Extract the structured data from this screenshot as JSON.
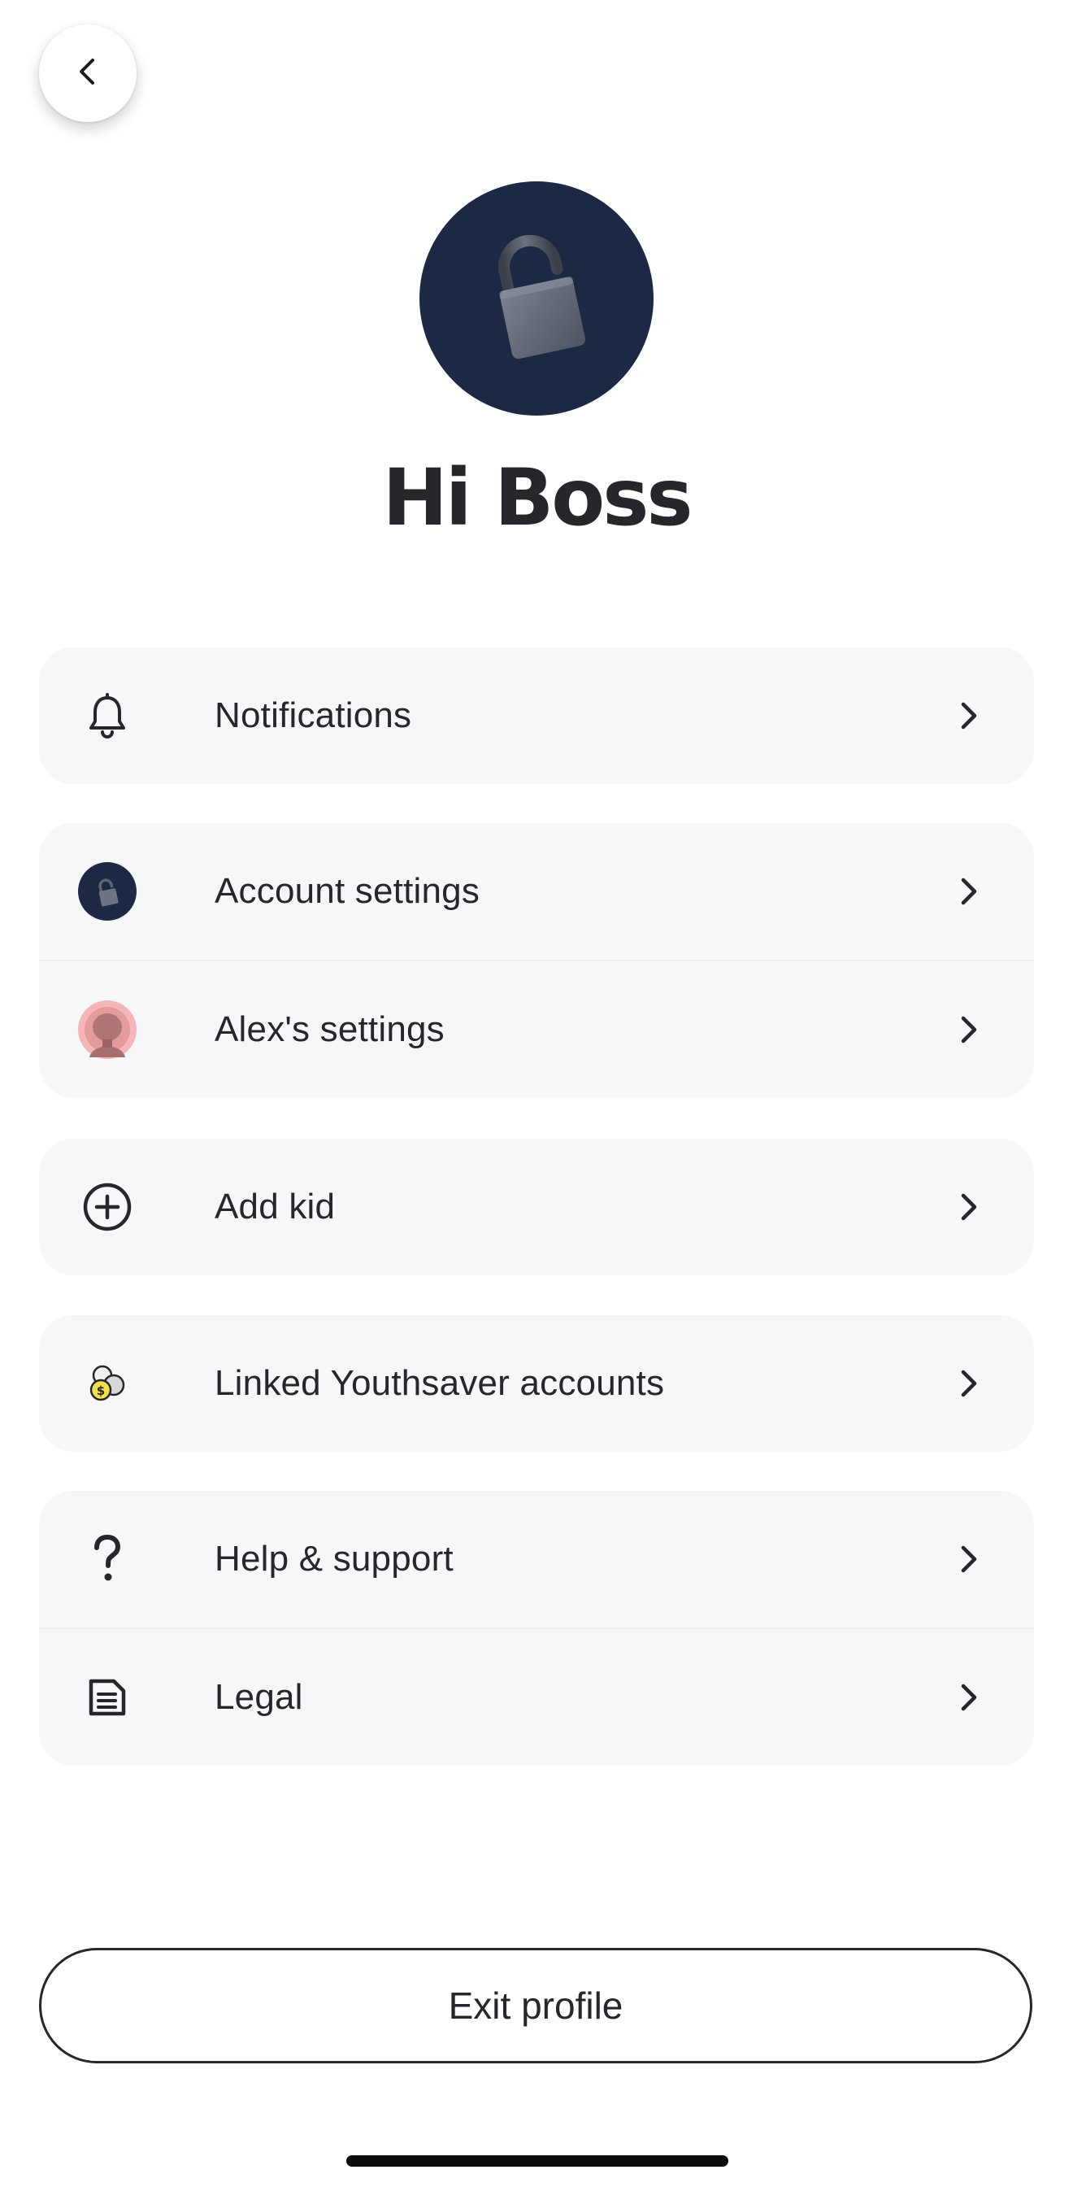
{
  "header": {
    "back_icon": "chevron-left-icon",
    "greeting": "Hi Boss",
    "avatar_icon": "padlock-icon",
    "avatar_bg": "#1c2844"
  },
  "menu": {
    "notifications": {
      "label": "Notifications",
      "icon": "bell-icon"
    },
    "account_settings": {
      "label": "Account settings",
      "icon": "padlock-avatar-icon"
    },
    "kid_settings": {
      "label": "Alex's settings",
      "icon": "kid-avatar-icon"
    },
    "add_kid": {
      "label": "Add kid",
      "icon": "plus-circle-icon"
    },
    "linked_accounts": {
      "label": "Linked Youthsaver accounts",
      "icon": "coins-icon"
    },
    "help": {
      "label": "Help & support",
      "icon": "question-mark-icon"
    },
    "legal": {
      "label": "Legal",
      "icon": "document-icon"
    }
  },
  "footer": {
    "exit_label": "Exit profile"
  },
  "colors": {
    "text": "#26272c",
    "card_bg": "#f6f7f9",
    "navy": "#1c2844",
    "kid_pink": "#f4b6b8"
  }
}
